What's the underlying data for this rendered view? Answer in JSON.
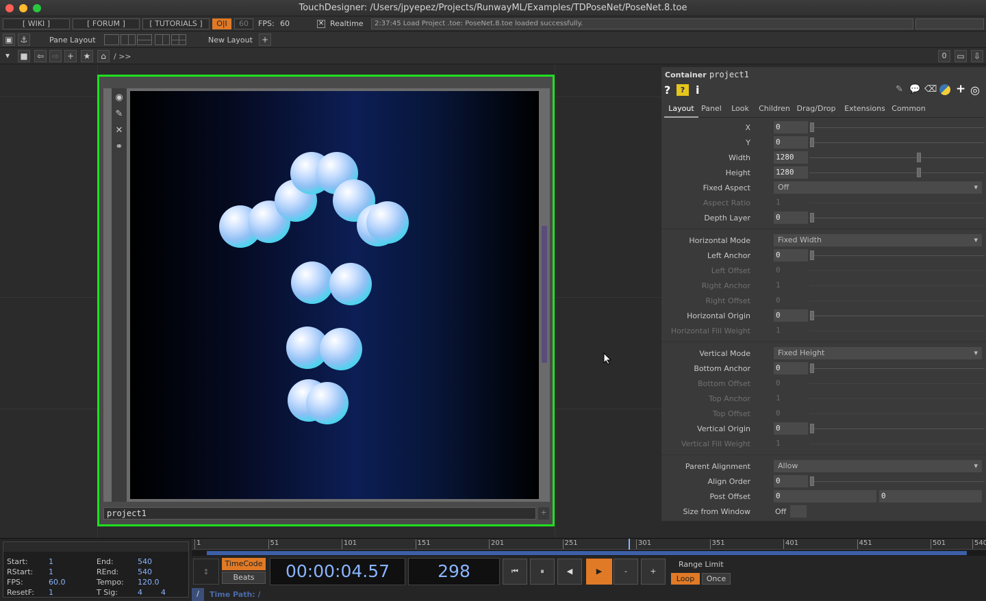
{
  "window": {
    "title": "TouchDesigner: /Users/jpyepez/Projects/RunwayML/Examples/TDPoseNet/PoseNet.8.toe"
  },
  "toolbar": {
    "wiki": "[ WIKI ]",
    "forum": "[ FORUM ]",
    "tutorials": "[ TUTORIALS ]",
    "oi": "O|I",
    "fps_cap": "60",
    "fps_label": "FPS:",
    "fps_value": "60",
    "realtime": "Realtime",
    "status": "2:37:45 Load Project .toe: PoseNet.8.toe loaded successfully."
  },
  "panebar": {
    "pane_layout": "Pane Layout",
    "new_layout": "New Layout"
  },
  "pathbar": {
    "path": "/ >>",
    "right_count": "0"
  },
  "container": {
    "name": "project1"
  },
  "params": {
    "type": "Container",
    "name": "project1",
    "tabs": [
      "Layout",
      "Panel",
      "Look",
      "Children",
      "Drag/Drop",
      "Extensions",
      "Common"
    ],
    "x": "0",
    "y": "0",
    "width": "1280",
    "height": "1280",
    "fixed_aspect": "Off",
    "aspect_ratio": "1",
    "depth_layer": "0",
    "horizontal_mode": "Fixed Width",
    "left_anchor": "0",
    "left_offset": "0",
    "right_anchor": "1",
    "right_offset": "0",
    "horizontal_origin": "0",
    "horizontal_fill_weight": "1",
    "vertical_mode": "Fixed Height",
    "bottom_anchor": "0",
    "bottom_offset": "0",
    "top_anchor": "1",
    "top_offset": "0",
    "vertical_origin": "0",
    "vertical_fill_weight": "1",
    "parent_alignment": "Allow",
    "align_order": "0",
    "post_offset_1": "0",
    "post_offset_2": "0",
    "size_from_window": "Off",
    "labels": {
      "x": "X",
      "y": "Y",
      "width": "Width",
      "height": "Height",
      "fixed_aspect": "Fixed Aspect",
      "aspect_ratio": "Aspect Ratio",
      "depth_layer": "Depth Layer",
      "horizontal_mode": "Horizontal Mode",
      "left_anchor": "Left Anchor",
      "left_offset": "Left Offset",
      "right_anchor": "Right Anchor",
      "right_offset": "Right Offset",
      "horizontal_origin": "Horizontal Origin",
      "horizontal_fill_weight": "Horizontal Fill Weight",
      "vertical_mode": "Vertical Mode",
      "bottom_anchor": "Bottom Anchor",
      "bottom_offset": "Bottom Offset",
      "top_anchor": "Top Anchor",
      "top_offset": "Top Offset",
      "vertical_origin": "Vertical Origin",
      "vertical_fill_weight": "Vertical Fill Weight",
      "parent_alignment": "Parent Alignment",
      "align_order": "Align Order",
      "post_offset": "Post Offset",
      "size_from_window": "Size from Window"
    }
  },
  "timeline": {
    "start_label": "Start:",
    "start": "1",
    "end_label": "End:",
    "end": "540",
    "rstart_label": "RStart:",
    "rstart": "1",
    "rend_label": "REnd:",
    "rend": "540",
    "fps_label": "FPS:",
    "fps": "60.0",
    "tempo_label": "Tempo:",
    "tempo": "120.0",
    "resetf_label": "ResetF:",
    "resetf": "1",
    "tsig_label": "T Sig:",
    "tsig_a": "4",
    "tsig_b": "4",
    "ticks": [
      "1",
      "51",
      "101",
      "151",
      "201",
      "251",
      "301",
      "351",
      "401",
      "451",
      "501",
      "540"
    ],
    "timecode_btn": "TimeCode",
    "beats_btn": "Beats",
    "timecode": "00:00:04.57",
    "frame": "298",
    "range_limit": "Range Limit",
    "loop": "Loop",
    "once": "Once",
    "time_path": "Time Path: /",
    "slash": "/"
  },
  "colors": {
    "accent": "#e07a26",
    "selection_green": "#1fe01f",
    "timecode_blue": "#8ab4ff"
  }
}
